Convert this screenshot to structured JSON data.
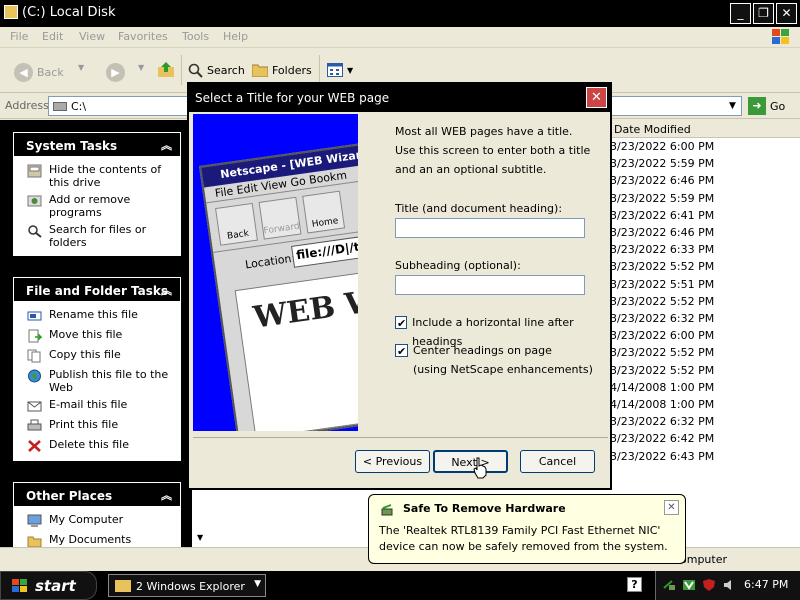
{
  "window": {
    "title": "(C:) Local Disk"
  },
  "menu": [
    "File",
    "Edit",
    "View",
    "Favorites",
    "Tools",
    "Help"
  ],
  "toolbar": {
    "back": "Back",
    "search": "Search",
    "folders": "Folders"
  },
  "address": {
    "label": "Address",
    "value": "C:\\",
    "go": "Go"
  },
  "system_tasks": {
    "title": "System Tasks",
    "items": [
      "Hide the contents of this drive",
      "Add or remove programs",
      "Search for files or folders"
    ]
  },
  "file_tasks": {
    "title": "File and Folder Tasks",
    "items": [
      "Rename this file",
      "Move this file",
      "Copy this file",
      "Publish this file to the Web",
      "E-mail this file",
      "Print this file",
      "Delete this file"
    ]
  },
  "other_places": {
    "title": "Other Places",
    "items": [
      "My Computer",
      "My Documents"
    ]
  },
  "filelist": {
    "column": "Date Modified",
    "dates": [
      "3/23/2022 6:00 PM",
      "3/23/2022 5:59 PM",
      "3/23/2022 6:46 PM",
      "3/23/2022 5:59 PM",
      "3/23/2022 6:41 PM",
      "3/23/2022 6:46 PM",
      "3/23/2022 6:33 PM",
      "3/23/2022 5:52 PM",
      "3/23/2022 5:51 PM",
      "3/23/2022 5:52 PM",
      "3/23/2022 6:32 PM",
      "3/23/2022 6:00 PM",
      "3/23/2022 5:52 PM",
      "3/23/2022 5:52 PM",
      "4/14/2008 1:00 PM",
      "4/14/2008 1:00 PM",
      "3/23/2022 6:32 PM",
      "3/23/2022 6:42 PM",
      "3/23/2022 6:43 PM"
    ]
  },
  "status": {
    "right": "omputer"
  },
  "dialog": {
    "title": "Select a Title for your WEB page",
    "intro": "Most all WEB pages have a title. Use this screen to enter both a title and an an optional subtitle.",
    "title_label": "Title (and document heading):",
    "title_value": "",
    "subheading_label": "Subheading (optional):",
    "subheading_value": "",
    "check1": "Include a horizontal line after headings",
    "check1_checked": true,
    "check2": "Center headings on page",
    "check2_sub": "(using NetScape enhancements)",
    "check2_checked": true,
    "prev": "< Previous",
    "next": "Next >",
    "cancel": "Cancel",
    "image": {
      "bar": "Netscape - [WEB Wizard",
      "menu": "File  Edit  View  Go  Bookm",
      "back": "Back",
      "forward": "Forward",
      "home": "Home",
      "location_label": "Location:",
      "location_value": "file:///D|/tmp",
      "page_text": "WEB Wi"
    }
  },
  "balloon": {
    "title": "Safe To Remove Hardware",
    "message": "The 'Realtek RTL8139 Family PCI Fast Ethernet NIC' device can now be safely removed from the system."
  },
  "taskbar": {
    "start": "start",
    "task": "2 Windows Explorer",
    "help": "?",
    "clock": "6:47 PM"
  },
  "colors": {
    "wizard_bg": "#0000ff",
    "balloon_bg": "#ffffe1",
    "titlebar": "#000000"
  }
}
